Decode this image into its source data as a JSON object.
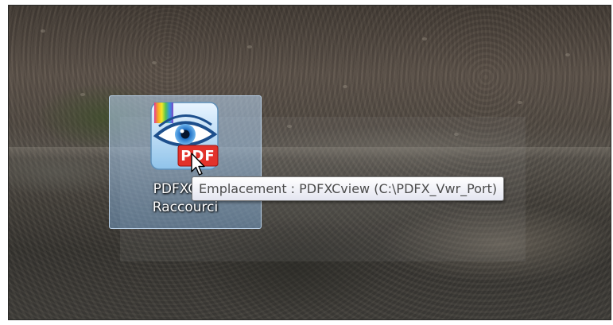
{
  "desktop": {
    "shortcut": {
      "label_line1": "PDFXCvie",
      "label_line2": "Raccourci",
      "icon": "pdfxchange-viewer-icon",
      "icon_badge": "PDF",
      "selected": true
    },
    "tooltip": {
      "text": "Emplacement : PDFXCview (C:\\PDFX_Vwr_Port)"
    },
    "cursor": "arrow-pointer-icon"
  },
  "colors": {
    "selection": "#9cc8f0",
    "tooltip_border": "#767676",
    "tooltip_text": "#4c4c4c",
    "pdf_badge": "#e2322b"
  }
}
